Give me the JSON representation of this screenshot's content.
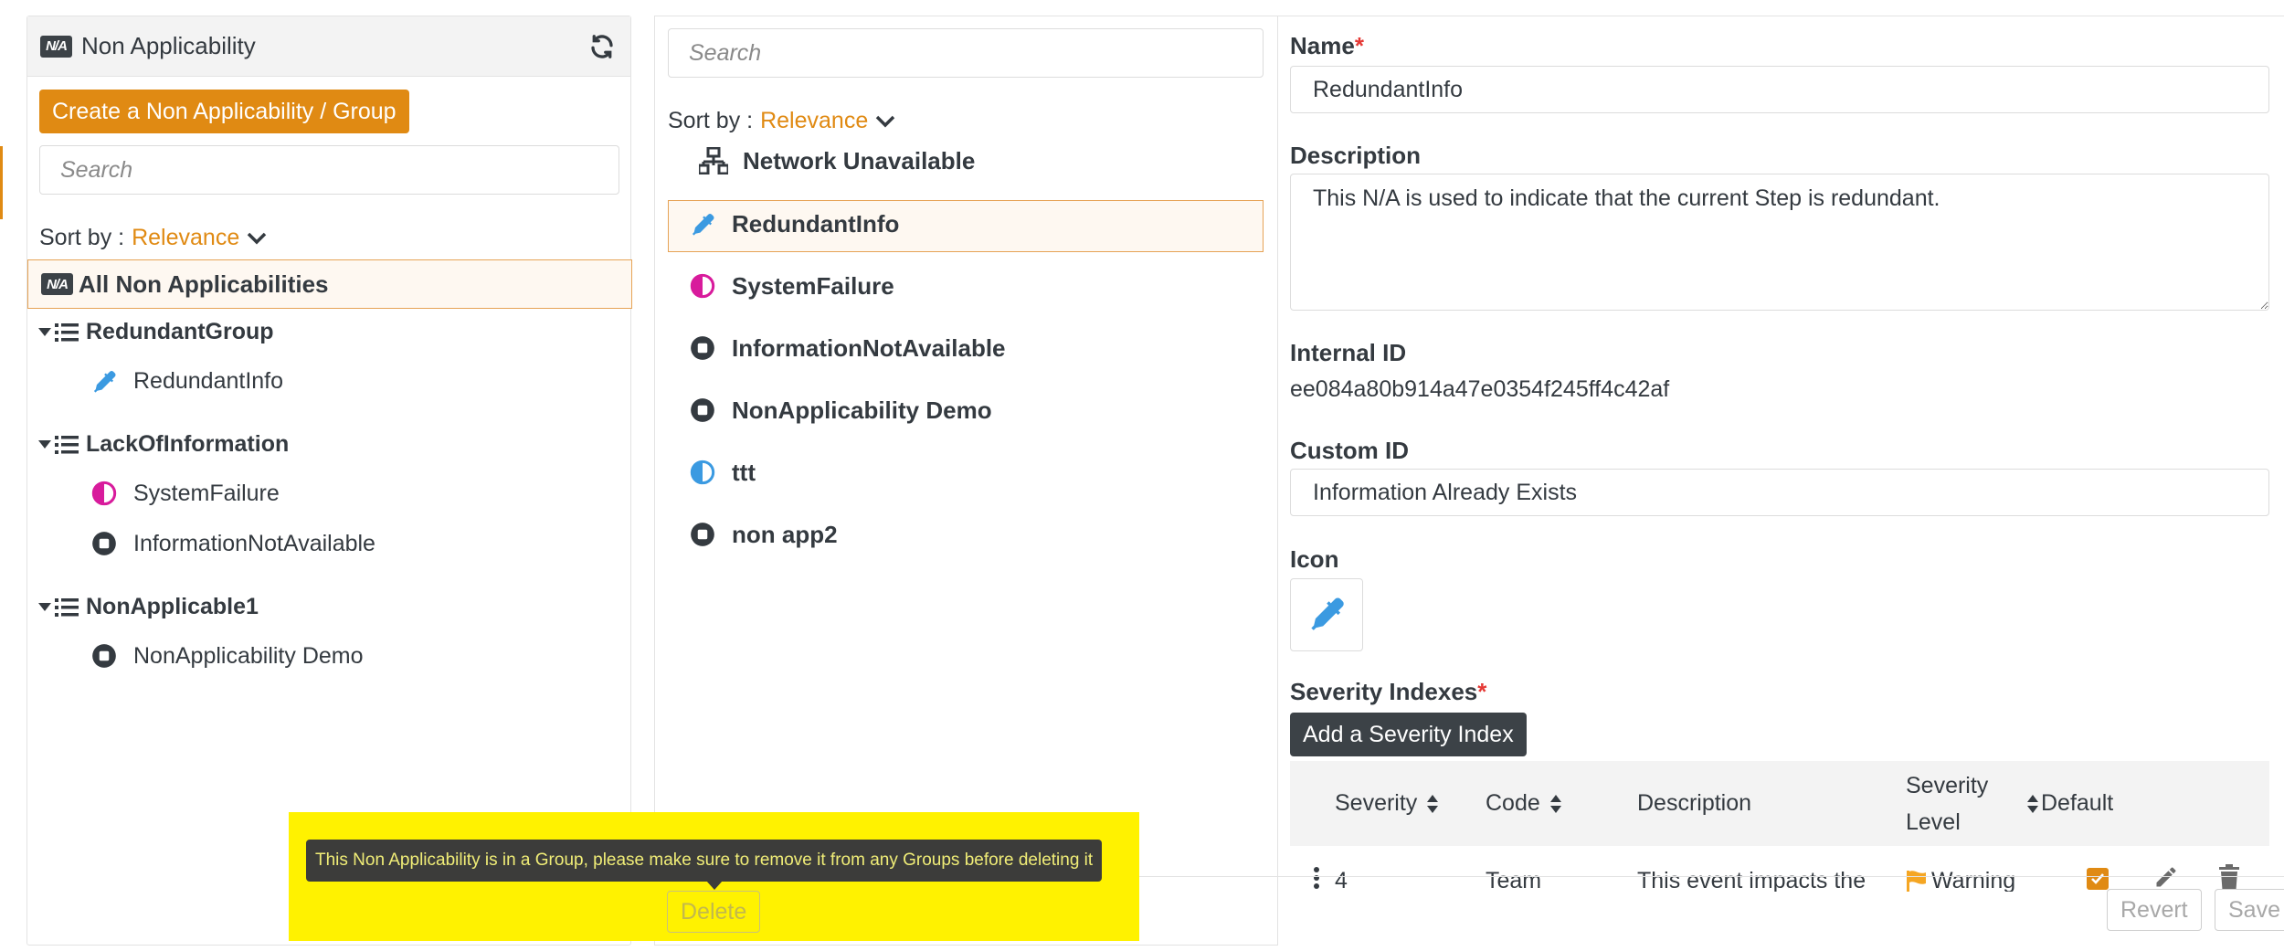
{
  "left": {
    "title": "Non Applicability",
    "create_label": "Create a Non Applicability / Group",
    "search_placeholder": "Search",
    "sort_label": "Sort by :",
    "sort_value": "Relevance",
    "all_label": "All Non Applicabilities",
    "na_badge": "N/A",
    "groups": [
      {
        "name": "RedundantGroup",
        "items": [
          "RedundantInfo"
        ]
      },
      {
        "name": "LackOfInformation",
        "items": [
          "SystemFailure",
          "InformationNotAvailable"
        ]
      },
      {
        "name": "NonApplicable1",
        "items": [
          "NonApplicability Demo"
        ]
      }
    ]
  },
  "middle": {
    "search_placeholder": "Search",
    "sort_label": "Sort by :",
    "sort_value": "Relevance",
    "items": [
      {
        "label": "Network Unavailable",
        "icon": "network-icon"
      },
      {
        "label": "RedundantInfo",
        "icon": "eyedropper-icon",
        "selected": true
      },
      {
        "label": "SystemFailure",
        "icon": "half-circle-icon"
      },
      {
        "label": "InformationNotAvailable",
        "icon": "stop-circle-icon"
      },
      {
        "label": "NonApplicability Demo",
        "icon": "stop-circle-icon"
      },
      {
        "label": "ttt",
        "icon": "half-circle-icon"
      },
      {
        "label": "non app2",
        "icon": "stop-circle-icon"
      }
    ]
  },
  "detail": {
    "name_label": "Name",
    "name_value": "RedundantInfo",
    "description_label": "Description",
    "description_value": "This N/A is used to indicate that the current Step is redundant.",
    "internal_id_label": "Internal ID",
    "internal_id_value": "ee084a80b914a47e0354f245ff4c42af",
    "custom_id_label": "Custom ID",
    "custom_id_value": "Information Already Exists",
    "icon_label": "Icon",
    "severity_label": "Severity Indexes",
    "required_mark": "*",
    "add_severity_label": "Add a Severity Index",
    "table": {
      "headers": {
        "severity": "Severity",
        "code": "Code",
        "description": "Description",
        "level_line1": "Severity",
        "level_line2": "Level",
        "default": "Default"
      },
      "row": {
        "severity": "4",
        "code": "Team",
        "description": "This event impacts the",
        "level": "Warning"
      }
    }
  },
  "footer": {
    "tooltip": "This Non Applicability is in a Group, please make sure to remove it from any Groups before deleting it",
    "delete_label": "Delete",
    "revert_label": "Revert",
    "save_label": "Save"
  },
  "colors": {
    "accent": "#e08a13",
    "dark": "#3c4247",
    "blue_icon": "#3b9ae1",
    "magenta_icon": "#d81b9c",
    "highlight": "#fff200",
    "warning_flag": "#f5a623"
  }
}
